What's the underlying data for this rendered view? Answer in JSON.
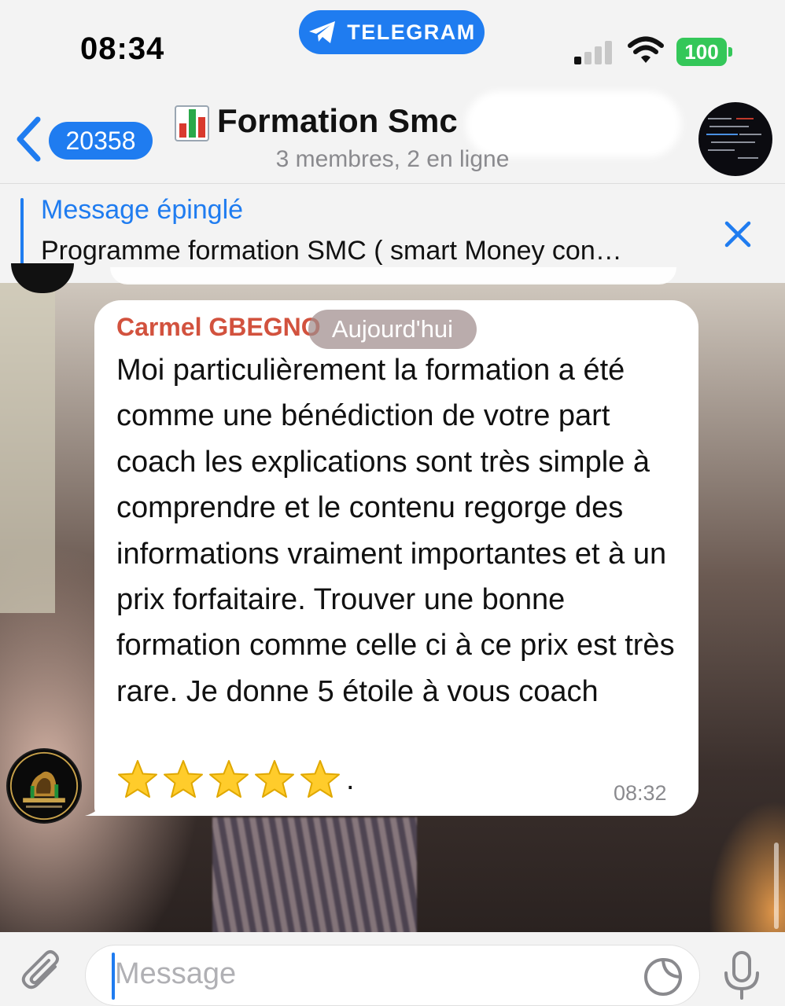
{
  "status_bar": {
    "time": "08:34",
    "app_pill_label": "TELEGRAM",
    "battery": "100",
    "icons": [
      "telegram-icon",
      "cellular-signal-icon",
      "wifi-icon",
      "battery-icon"
    ]
  },
  "header": {
    "unread_count": "20358",
    "chat_title": "Formation Smc",
    "subtitle": "3 membres, 2 en ligne",
    "icons": [
      "back-chevron-icon",
      "bar-chart-emoji-icon",
      "chat-avatar"
    ]
  },
  "pinned": {
    "label": "Message épinglé",
    "text": "Programme formation SMC ( smart Money con…"
  },
  "message": {
    "sender": "Carmel GBEGNON",
    "date_pill": "Aujourd'hui",
    "text": "Moi particulièrement la formation a été comme une bénédiction de votre part coach les explications sont très simple à comprendre et le contenu regorge des informations vraiment importantes et à un prix forfaitaire. Trouver une bonne formation comme celle ci à ce prix est très rare. Je donne 5 étoile à vous coach",
    "star_count": 5,
    "trailing": ".",
    "time": "08:32"
  },
  "input": {
    "placeholder": "Message",
    "icons": [
      "paperclip-icon",
      "sticker-icon",
      "microphone-icon"
    ]
  },
  "colors": {
    "accent": "#1f7cf0",
    "sender": "#d2523e",
    "battery": "#34c759",
    "bubble": "#ffffff"
  }
}
